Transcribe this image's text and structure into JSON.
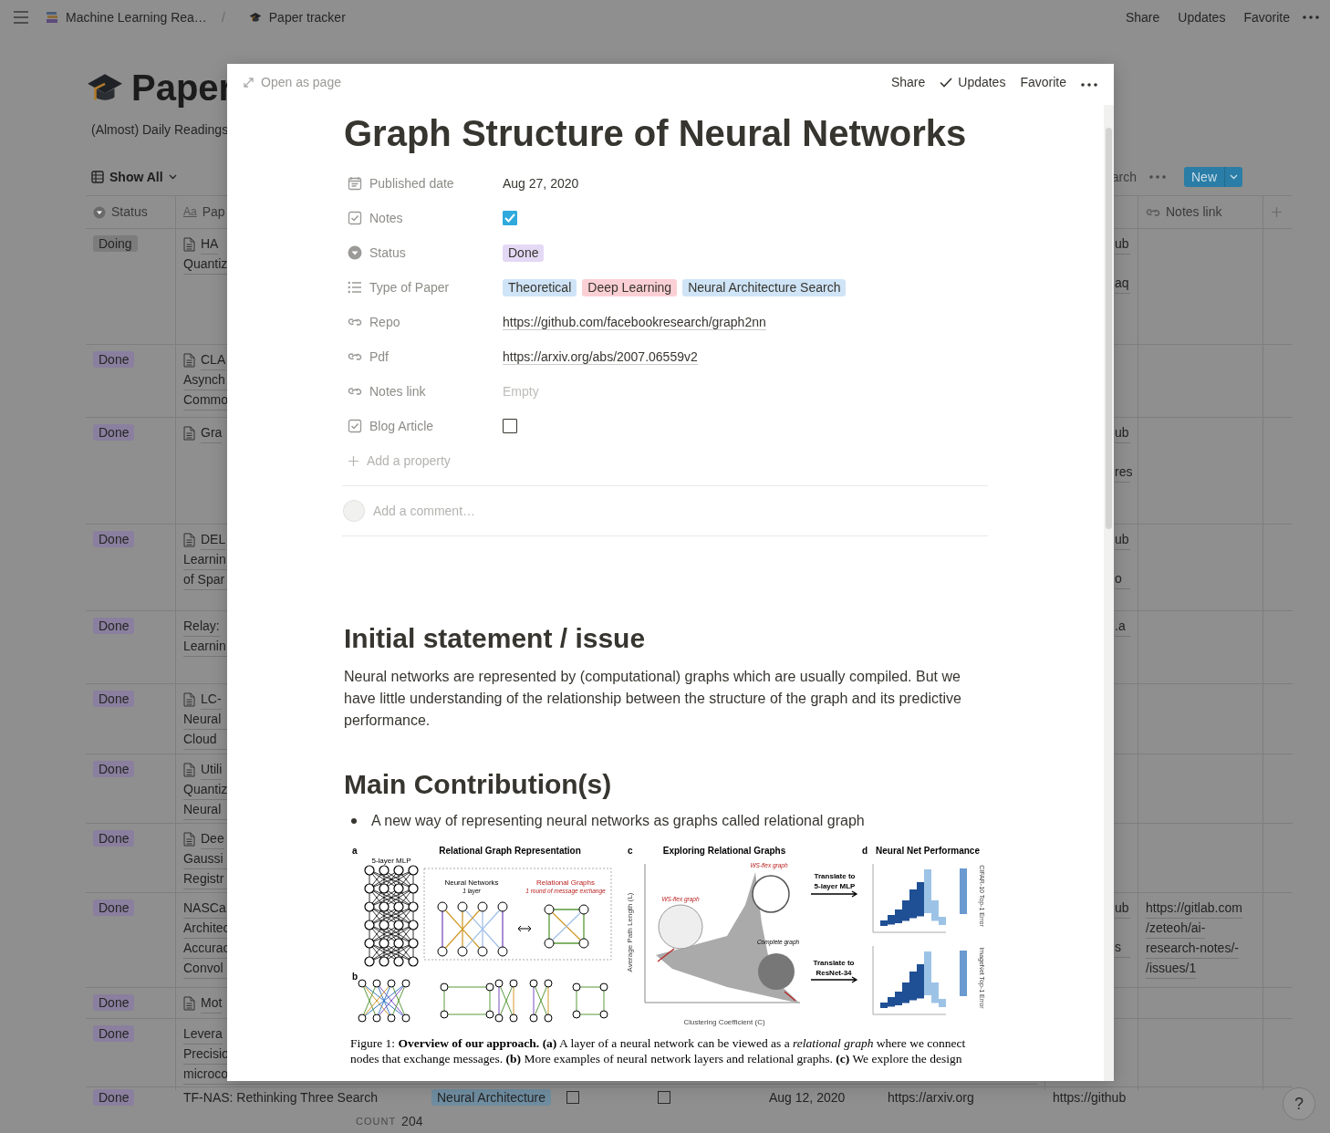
{
  "topbar": {
    "breadcrumbs": [
      {
        "label": "Machine Learning Rea…"
      },
      {
        "label": "Paper tracker"
      }
    ],
    "separator": "/",
    "actions": [
      "Share",
      "Updates",
      "Favorite"
    ]
  },
  "database": {
    "title": "Paper",
    "description": "(Almost) Daily Readings",
    "view": "Show All",
    "search": "arch",
    "new_button": "New",
    "headers": {
      "status": "Status",
      "paper_icon": "Aa",
      "paper": "Pap",
      "notes_link": "Notes link"
    },
    "rows": [
      {
        "status": "Doing",
        "color": "#7c7c7c",
        "page_icon": true,
        "title": [
          "HA",
          "Quantiz"
        ],
        "repo": [
          "ub",
          "aq"
        ],
        "notes_link": []
      },
      {
        "status": "Done",
        "color": "#8a7f9e",
        "page_icon": true,
        "title": [
          "CLA",
          "Asynch",
          "Commo"
        ],
        "repo": [],
        "notes_link": []
      },
      {
        "status": "Done",
        "color": "#8a7f9e",
        "page_icon": true,
        "title": [
          "Gra"
        ],
        "repo": [
          "ub",
          "res"
        ],
        "notes_link": []
      },
      {
        "status": "Done",
        "color": "#8a7f9e",
        "page_icon": true,
        "title": [
          "DEL",
          "Learnin",
          "of Spar"
        ],
        "repo": [
          "ub",
          "o"
        ],
        "notes_link": []
      },
      {
        "status": "Done",
        "color": "#8a7f9e",
        "page_icon": false,
        "title": [
          "Relay:",
          "Learnin"
        ],
        "repo": [
          ".a"
        ],
        "notes_link": []
      },
      {
        "status": "Done",
        "color": "#8a7f9e",
        "page_icon": true,
        "title": [
          "LC-",
          "Neural",
          "Cloud"
        ],
        "repo": [],
        "notes_link": []
      },
      {
        "status": "Done",
        "color": "#8a7f9e",
        "page_icon": true,
        "title": [
          "Utili",
          "Quantiz",
          "Neural"
        ],
        "repo": [],
        "notes_link": []
      },
      {
        "status": "Done",
        "color": "#8a7f9e",
        "page_icon": true,
        "title": [
          "Dee",
          "Gaussi",
          "Registr"
        ],
        "repo": [],
        "notes_link": []
      },
      {
        "status": "Done",
        "color": "#8a7f9e",
        "page_icon": false,
        "title": [
          "NASCa",
          "Architec",
          "Accurac",
          "Convol"
        ],
        "repo": [
          "ub",
          "s"
        ],
        "notes_link": [
          "https://gitlab.com",
          "/zeteoh/ai-",
          "research-notes/-",
          "/issues/1"
        ]
      },
      {
        "status": "Done",
        "color": "#8a7f9e",
        "page_icon": true,
        "title": [
          "Mot"
        ],
        "repo": [],
        "notes_link": []
      },
      {
        "status": "Done",
        "color": "#8a7f9e",
        "page_icon": false,
        "title": [
          "Levera",
          "Precisio",
          "microco"
        ],
        "repo": [],
        "notes_link": []
      }
    ],
    "last_row": {
      "status": "Done",
      "color": "#8a7f9e",
      "title": "TF-NAS: Rethinking Three Search",
      "type": "Neural Architecture",
      "notes": false,
      "blog": false,
      "date": "Aug 12, 2020",
      "pdf": "https://arxiv.org",
      "repo": "https://github"
    },
    "count_label": "COUNT",
    "count": "204"
  },
  "help": "?",
  "modal": {
    "open_as_page": "Open as page",
    "actions": [
      "Share",
      "Updates",
      "Favorite"
    ],
    "title": "Graph Structure of Neural Networks",
    "properties": [
      {
        "kind": "date",
        "label": "Published date",
        "value": "Aug 27, 2020"
      },
      {
        "kind": "checkbox",
        "label": "Notes",
        "checked": true
      },
      {
        "kind": "status",
        "label": "Status",
        "tags": [
          {
            "label": "Done",
            "color": "#e4d9f5"
          }
        ]
      },
      {
        "kind": "multi",
        "label": "Type of Paper",
        "tags": [
          {
            "label": "Theoretical",
            "color": "#cfe4f7"
          },
          {
            "label": "Deep Learning",
            "color": "#fbd0d4"
          },
          {
            "label": "Neural Architecture Search",
            "color": "#cfe4f7"
          }
        ]
      },
      {
        "kind": "url",
        "label": "Repo",
        "value": "https://github.com/facebookresearch/graph2nn"
      },
      {
        "kind": "url",
        "label": "Pdf",
        "value": "https://arxiv.org/abs/2007.06559v2"
      },
      {
        "kind": "url",
        "label": "Notes link",
        "placeholder": "Empty"
      },
      {
        "kind": "checkbox",
        "label": "Blog Article",
        "checked": false
      }
    ],
    "add_property": "Add a property",
    "comment_placeholder": "Add a comment…",
    "blocks": [
      {
        "kind": "heading",
        "text": "Initial statement / issue"
      },
      {
        "kind": "paragraph",
        "text": "Neural networks are represented by (computational) graphs which are usually compiled. But we have little understanding of the relationship between the structure of the graph and its predictive performance."
      },
      {
        "kind": "heading",
        "text": "Main Contribution(s)"
      },
      {
        "kind": "bullet",
        "text": "A new way of representing neural networks as graphs called relational graph"
      },
      {
        "kind": "figure",
        "labels": [
          {
            "kind": "letter",
            "text": "a"
          },
          {
            "kind": "title",
            "text": "Relational Graph Representation"
          },
          {
            "kind": "label",
            "text": "5-layer MLP"
          },
          {
            "kind": "label",
            "text": "Neural Networks"
          },
          {
            "kind": "note",
            "text": "1 layer"
          },
          {
            "kind": "red",
            "text": "Relational Graphs"
          },
          {
            "kind": "rednote",
            "text": "1 round of message exchange"
          },
          {
            "kind": "letter",
            "text": "b"
          },
          {
            "kind": "letter",
            "text": "c"
          },
          {
            "kind": "title",
            "text": "Exploring Relational Graphs"
          },
          {
            "kind": "rednote",
            "text": "WS-flex graph"
          },
          {
            "kind": "rednote",
            "text": "WS-flex graph"
          },
          {
            "kind": "note",
            "text": "Complete graph"
          },
          {
            "kind": "vaxis",
            "text": "Average Path Length (L)"
          },
          {
            "kind": "axis",
            "text": "Clustering Coefficient (C)"
          },
          {
            "kind": "letter",
            "text": "d"
          },
          {
            "kind": "title",
            "text": "Neural Net Performance"
          },
          {
            "kind": "bold",
            "text": "Translate to"
          },
          {
            "kind": "bold",
            "text": "5-layer MLP"
          },
          {
            "kind": "bold",
            "text": "Translate to"
          },
          {
            "kind": "bold",
            "text": "ResNet-34"
          },
          {
            "kind": "vaxis2",
            "text": "CIFAR-10 Top-1 Error"
          },
          {
            "kind": "vaxis2",
            "text": "ImageNet Top-1 Error"
          }
        ],
        "caption": "Figure 1: **Overview of our approach.** **(a)** A layer of a neural network can be viewed as a *relational graph* where we connect nodes that exchange messages. **(b)** More examples of neural network layers and relational graphs. **(c)** We explore the design"
      }
    ]
  }
}
